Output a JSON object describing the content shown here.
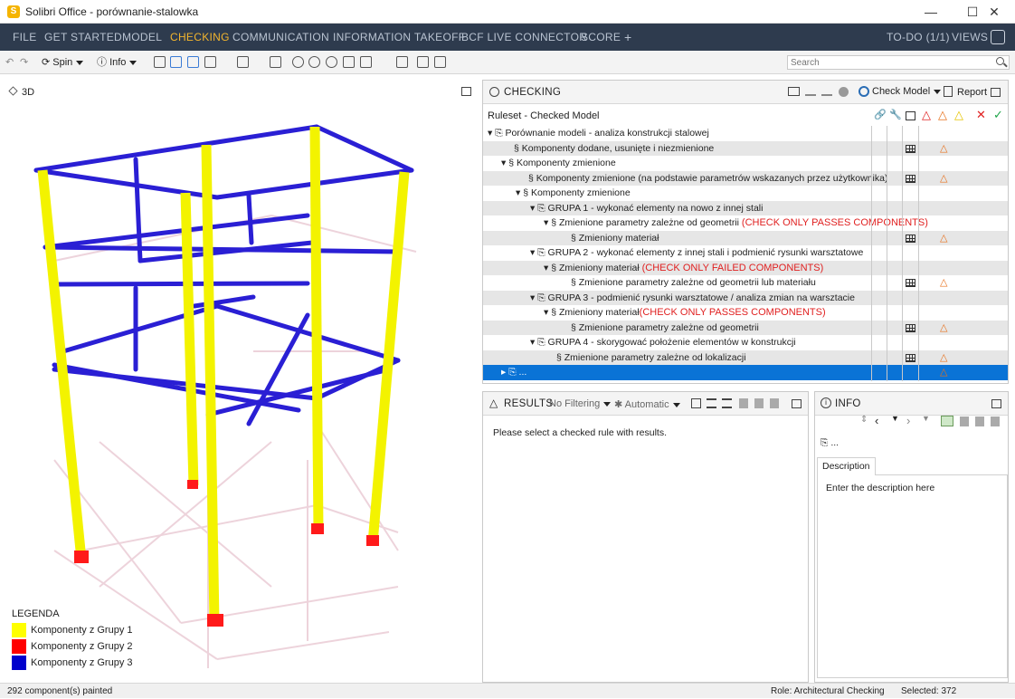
{
  "window": {
    "app_icon_letter": "S",
    "title": "Solibri Office - porównanie-stalowka"
  },
  "menu": {
    "items": [
      "FILE",
      "GET STARTED",
      "MODEL",
      "CHECKING",
      "COMMUNICATION",
      "INFORMATION TAKEOFF",
      "BCF LIVE CONNECTOR",
      "SCORE",
      "+"
    ],
    "active": "CHECKING",
    "todo": "TO-DO (1/1)",
    "views": "VIEWS"
  },
  "toolbar": {
    "spin_label": "Spin",
    "info_label": "Info",
    "search_placeholder": "Search"
  },
  "view3d": {
    "title": "3D",
    "legend": {
      "title": "LEGENDA",
      "items": [
        {
          "label": "Komponenty z Grupy 1",
          "color": "#ffff00"
        },
        {
          "label": "Komponenty z Grupy 2",
          "color": "#ff0000"
        },
        {
          "label": "Komponenty z Grupy 3",
          "color": "#0000cc"
        }
      ]
    }
  },
  "checking": {
    "title": "CHECKING",
    "check_model_label": "Check Model",
    "report_label": "Report",
    "column_header": "Ruleset - Checked Model",
    "rows": [
      {
        "text": "Porównanie modeli - analiza konstrukcji stalowej",
        "note": "",
        "grid": false,
        "warn": false
      },
      {
        "text": "Komponenty dodane, usunięte i niezmienione",
        "note": "",
        "grid": true,
        "warn": true
      },
      {
        "text": "Komponenty zmienione",
        "note": "",
        "grid": false,
        "warn": false
      },
      {
        "text": "Komponenty zmienione (na podstawie parametrów wskazanych przez użytkownika)",
        "note": "",
        "grid": true,
        "warn": true
      },
      {
        "text": "Komponenty zmienione",
        "note": "",
        "grid": false,
        "warn": false
      },
      {
        "text": "GRUPA 1 - wykonać elementy na nowo z innej stali",
        "note": "",
        "grid": false,
        "warn": false
      },
      {
        "text": "Zmienione parametry zależne od geometrii",
        "note": "(CHECK ONLY PASSES COMPONENTS)",
        "grid": false,
        "warn": false
      },
      {
        "text": "Zmieniony materiał",
        "note": "",
        "grid": true,
        "warn": true
      },
      {
        "text": "GRUPA 2 - wykonać elementy z innej stali i podmienić rysunki warsztatowe",
        "note": "",
        "grid": false,
        "warn": false
      },
      {
        "text": "Zmieniony materiał",
        "note": "(CHECK ONLY FAILED COMPONENTS)",
        "grid": false,
        "warn": false
      },
      {
        "text": "Zmienione parametry zależne od geometrii lub materiału",
        "note": "",
        "grid": true,
        "warn": true
      },
      {
        "text": "GRUPA 3 - podmienić rysunki warsztatowe / analiza zmian na warsztacie",
        "note": "",
        "grid": false,
        "warn": false
      },
      {
        "text": "Zmieniony materiał",
        "note": "(CHECK ONLY PASSES COMPONENTS)",
        "grid": false,
        "warn": false
      },
      {
        "text": "Zmienione parametry zależne od geometrii",
        "note": "",
        "grid": true,
        "warn": true
      },
      {
        "text": "GRUPA 4 - skorygować położenie elementów w konstrukcji",
        "note": "",
        "grid": false,
        "warn": false
      },
      {
        "text": "Zmienione parametry zależne od lokalizacji",
        "note": "",
        "grid": true,
        "warn": true
      },
      {
        "text": "...",
        "note": "",
        "grid": false,
        "warn": true
      }
    ]
  },
  "results": {
    "title": "RESULTS",
    "filter_label": "No Filtering",
    "mode_label": "Automatic",
    "message": "Please select a checked rule with results."
  },
  "info": {
    "title": "INFO",
    "item_label": "...",
    "tab_label": "Description",
    "placeholder": "Enter the description here"
  },
  "status": {
    "left": "292 component(s) painted",
    "role": "Role: Architectural Checking",
    "selected": "Selected: 372"
  }
}
